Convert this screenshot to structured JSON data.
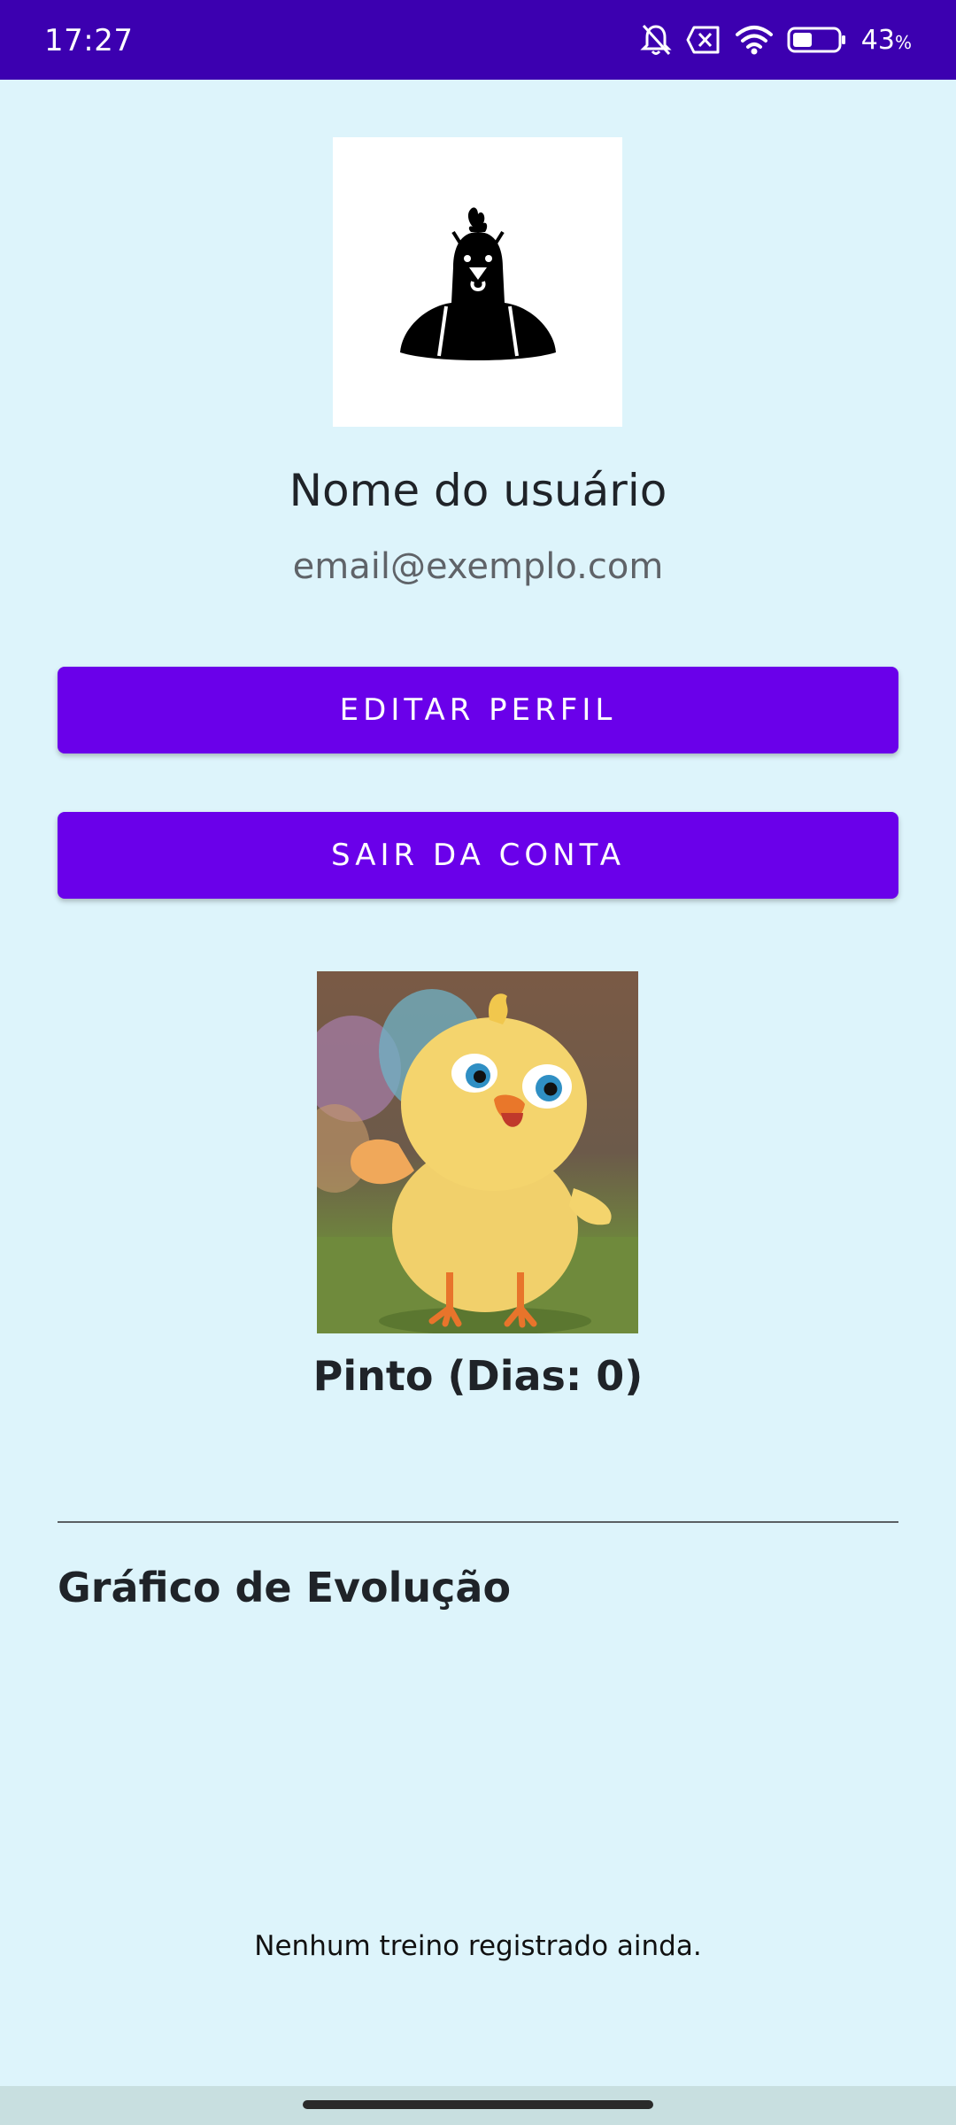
{
  "status_bar": {
    "time": "17:27",
    "battery_percent": "43",
    "battery_unit": "%",
    "battery_level": 0.43,
    "icons": [
      "bell-off-icon",
      "close-box-icon",
      "wifi-icon",
      "battery-icon"
    ]
  },
  "profile": {
    "avatar_icon": "rooster-icon",
    "name": "Nome do usuário",
    "email": "email@exemplo.com"
  },
  "actions": {
    "edit_label": "EDITAR PERFIL",
    "logout_label": "SAIR DA CONTA"
  },
  "pet": {
    "image": "chick-illustration",
    "caption": "Pinto (Dias: 0)"
  },
  "chart": {
    "title": "Gráfico de Evolução",
    "empty_message": "Nenhum treino registrado ainda."
  },
  "colors": {
    "status_bar": "#3c00b0",
    "background": "#ddf4fb",
    "button": "#6a00ea",
    "nav_bar": "#c8dfe0"
  }
}
